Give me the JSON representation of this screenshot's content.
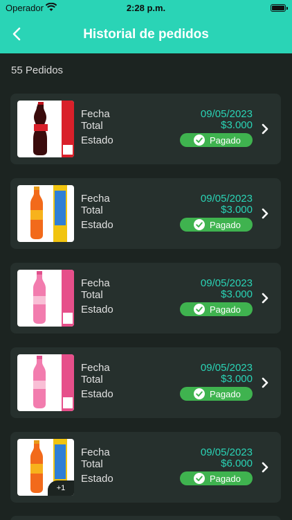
{
  "status_bar": {
    "carrier": "Operador",
    "time": "2:28 p.m."
  },
  "nav": {
    "title": "Historial de pedidos"
  },
  "order_count_label": "55 Pedidos",
  "labels": {
    "fecha": "Fecha",
    "total": "Total",
    "estado": "Estado"
  },
  "orders": [
    {
      "date": "09/05/2023",
      "total": "$3.000",
      "status": "Pagado",
      "product_icon": "cola-bottle-icon",
      "extra_items": ""
    },
    {
      "date": "09/05/2023",
      "total": "$3.000",
      "status": "Pagado",
      "product_icon": "orange-soda-bottle-icon",
      "extra_items": ""
    },
    {
      "date": "09/05/2023",
      "total": "$3.000",
      "status": "Pagado",
      "product_icon": "pink-soda-bottle-icon",
      "extra_items": ""
    },
    {
      "date": "09/05/2023",
      "total": "$3.000",
      "status": "Pagado",
      "product_icon": "pink-soda-bottle-icon",
      "extra_items": ""
    },
    {
      "date": "09/05/2023",
      "total": "$6.000",
      "status": "Pagado",
      "product_icon": "orange-soda-bottle-icon",
      "extra_items": "+1"
    }
  ],
  "colors": {
    "accent": "#2ad4b6",
    "paid": "#3fb34f",
    "background": "#1c2421",
    "card": "#26302d"
  }
}
